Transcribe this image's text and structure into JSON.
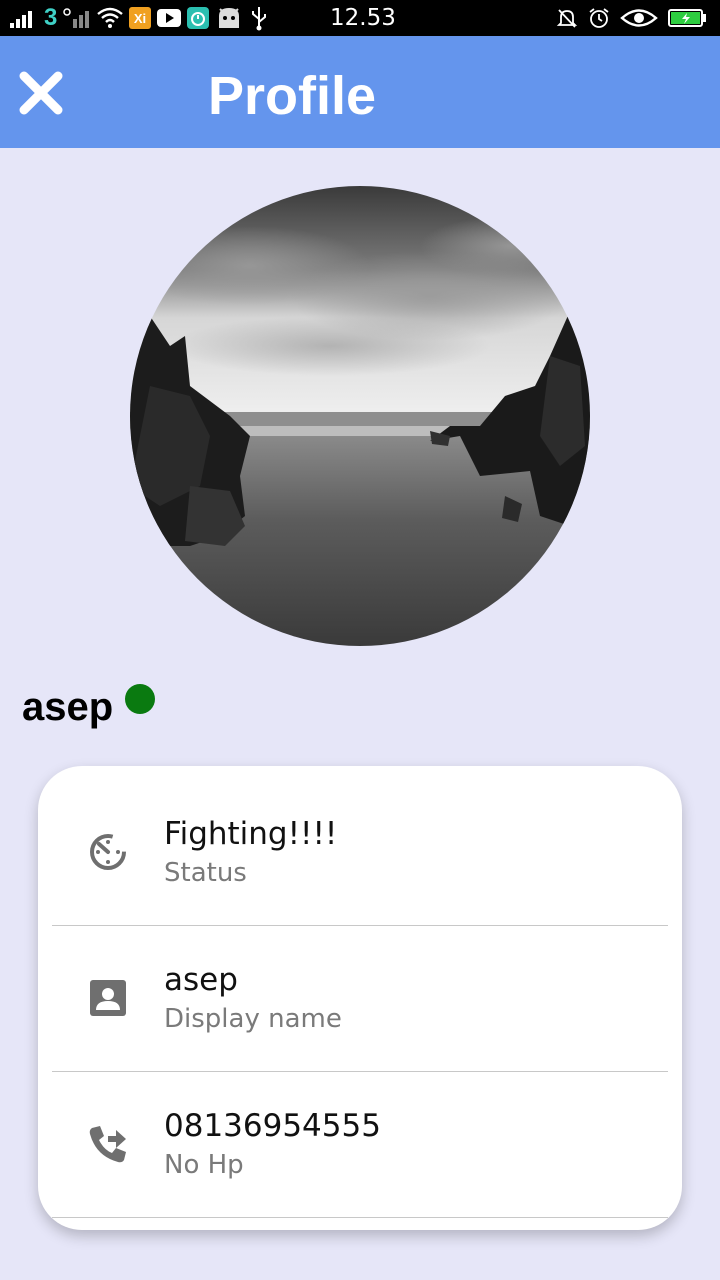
{
  "status_bar": {
    "time": "12.53",
    "carrier_badge": "3",
    "icons": [
      "signal-icon",
      "carrier-3-icon",
      "signal-2-icon",
      "wifi-icon",
      "app-xi-icon",
      "youtube-icon",
      "timer-app-icon",
      "android-icon",
      "usb-icon",
      "silent-bell-icon",
      "alarm-icon",
      "eye-icon",
      "battery-charging-icon"
    ]
  },
  "app_bar": {
    "title": "Profile",
    "close_icon": "close-icon",
    "background": "#6495ed"
  },
  "profile": {
    "name": "asep",
    "online_color": "#0a7a10"
  },
  "details": [
    {
      "icon": "status-timer-icon",
      "value": "Fighting!!!!",
      "label": "Status"
    },
    {
      "icon": "contact-card-icon",
      "value": "asep",
      "label": "Display name"
    },
    {
      "icon": "phone-forward-icon",
      "value": "08136954555",
      "label": "No Hp"
    }
  ]
}
